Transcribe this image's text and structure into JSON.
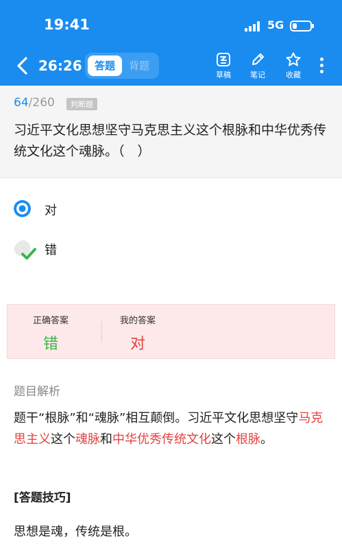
{
  "status_bar": {
    "time": "19:41",
    "network": "5G"
  },
  "header": {
    "timer": "26:26",
    "modes": [
      {
        "label": "答题",
        "active": true
      },
      {
        "label": "背题",
        "active": false
      }
    ],
    "tools": [
      {
        "icon": "draft-icon",
        "label": "草稿"
      },
      {
        "icon": "pen-icon",
        "label": "笔记"
      },
      {
        "icon": "star-icon",
        "label": "收藏"
      }
    ]
  },
  "question": {
    "current": "64",
    "separator": "/",
    "total": "260",
    "type": "判断题",
    "text": "习近平文化思想坚守马克思主义这个根脉和中华优秀传统文化这个魂脉。（　）"
  },
  "options": [
    {
      "label": "对",
      "state": "selected"
    },
    {
      "label": "错",
      "state": "correct"
    }
  ],
  "answer": {
    "correct_title": "正确答案",
    "correct_value": "错",
    "mine_title": "我的答案",
    "mine_value": "对"
  },
  "analysis": {
    "title": "题目解析",
    "segments": [
      {
        "text": "题干“根脉”和“魂脉”相互颠倒。习近平文化思想坚守",
        "highlight": false
      },
      {
        "text": "马克思主义",
        "highlight": true
      },
      {
        "text": "这个",
        "highlight": false
      },
      {
        "text": "魂脉",
        "highlight": true
      },
      {
        "text": "和",
        "highlight": false
      },
      {
        "text": "中华优秀传统文化",
        "highlight": true
      },
      {
        "text": "这个",
        "highlight": false
      },
      {
        "text": "根脉",
        "highlight": true
      },
      {
        "text": "。",
        "highlight": false
      }
    ],
    "tip_title": "[答题技巧]",
    "tip_text": "思想是魂，传统是根。"
  },
  "colors": {
    "brand_blue": "#1a8cf0",
    "correct_green": "#3bb54a",
    "wrong_red": "#e8413e",
    "answer_box_bg": "#fde9e9"
  }
}
